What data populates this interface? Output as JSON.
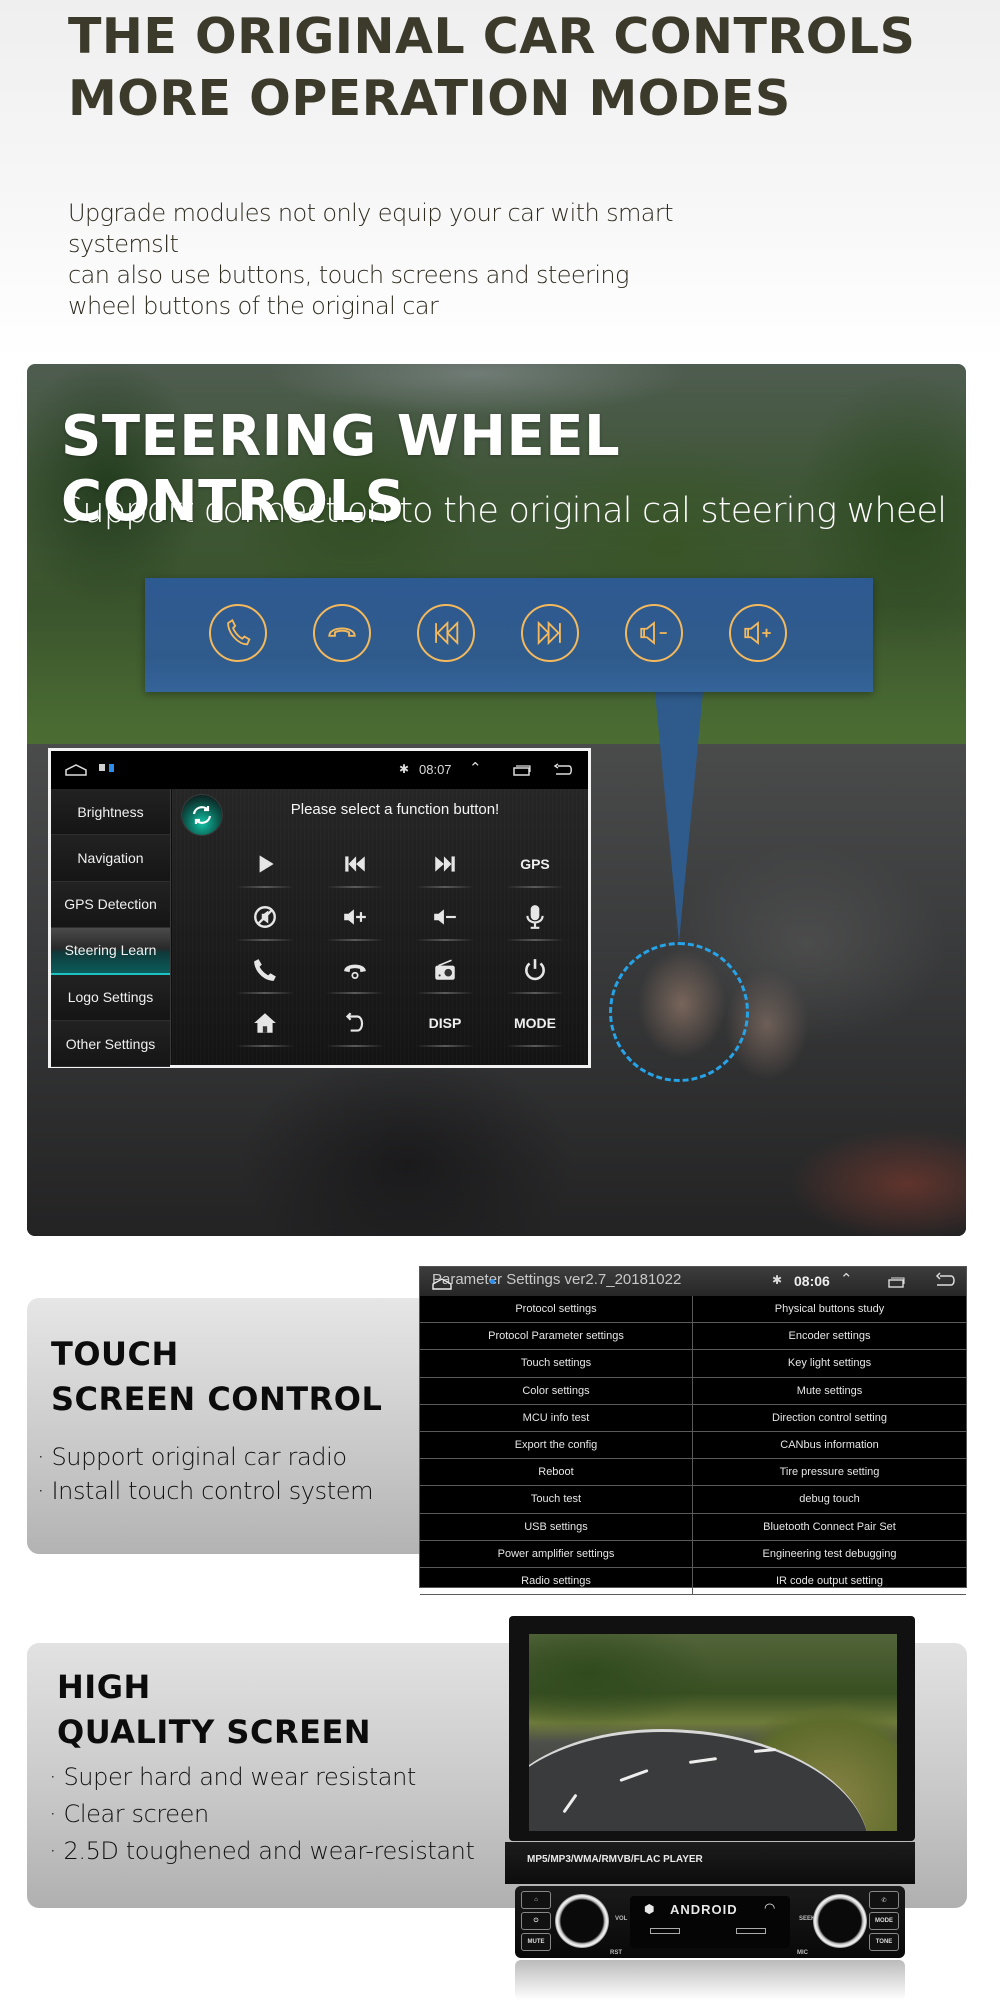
{
  "hero": {
    "title_line1": "THE ORIGINAL CAR CONTROLS",
    "title_line2": "MORE OPERATION MODES",
    "desc_line1": "Upgrade modules not only equip your car with smart systemsIt",
    "desc_line2": "can also use buttons, touch screens and steering",
    "desc_line3": "wheel buttons of the original car"
  },
  "steering": {
    "title": "STEERING WHEEL CONTROLS",
    "subtitle": "Support connection to the original cal steering wheel",
    "keys": [
      {
        "icon": "phone-answer-icon"
      },
      {
        "icon": "phone-hangup-icon"
      },
      {
        "icon": "previous-track-icon"
      },
      {
        "icon": "next-track-icon"
      },
      {
        "icon": "volume-down-icon"
      },
      {
        "icon": "volume-up-icon"
      }
    ],
    "accent_color": "#2f5b8c",
    "key_color": "#f4b95c",
    "highlight_color": "#27a3e8"
  },
  "unit": {
    "status": {
      "time": "08:07"
    },
    "sidebar": [
      {
        "label": "Brightness",
        "active": false
      },
      {
        "label": "Navigation",
        "active": false
      },
      {
        "label": "GPS Detection",
        "active": false
      },
      {
        "label": "Steering Learn",
        "active": true
      },
      {
        "label": "Logo Settings",
        "active": false
      },
      {
        "label": "Other Settings",
        "active": false
      }
    ],
    "prompt": "Please select a function button!",
    "functions": [
      {
        "icon": "play-icon",
        "label": ""
      },
      {
        "icon": "previous-track-icon",
        "label": ""
      },
      {
        "icon": "next-track-icon",
        "label": ""
      },
      {
        "icon": "",
        "label": "GPS"
      },
      {
        "icon": "mute-icon",
        "label": ""
      },
      {
        "icon": "volume-up-icon",
        "label": ""
      },
      {
        "icon": "volume-down-icon",
        "label": ""
      },
      {
        "icon": "microphone-icon",
        "label": ""
      },
      {
        "icon": "phone-answer-icon",
        "label": ""
      },
      {
        "icon": "phone-hangup-icon",
        "label": ""
      },
      {
        "icon": "radio-icon",
        "label": ""
      },
      {
        "icon": "power-icon",
        "label": ""
      },
      {
        "icon": "home-icon",
        "label": ""
      },
      {
        "icon": "back-icon",
        "label": ""
      },
      {
        "icon": "",
        "label": "DISP"
      },
      {
        "icon": "",
        "label": "MODE"
      }
    ]
  },
  "touch": {
    "title_line1": "TOUCH",
    "title_line2": "SCREEN CONTROL",
    "bullets": [
      "Support original car radio",
      "Install touch control system"
    ]
  },
  "param": {
    "title": "Parameter Settings ver2.7_20181022",
    "time": "08:06",
    "rows": [
      [
        "Protocol settings",
        "Physical buttons study"
      ],
      [
        "Protocol Parameter settings",
        "Encoder settings"
      ],
      [
        "Touch settings",
        "Key light settings"
      ],
      [
        "Color settings",
        "Mute settings"
      ],
      [
        "MCU info test",
        "Direction control setting"
      ],
      [
        "Export the config",
        "CANbus information"
      ],
      [
        "Reboot",
        "Tire pressure setting"
      ],
      [
        "Touch test",
        "debug touch"
      ],
      [
        "USB settings",
        "Bluetooth Connect Pair Set"
      ],
      [
        "Power amplifier settings",
        "Engineering test debugging"
      ],
      [
        "Radio settings",
        "IR code output setting"
      ]
    ]
  },
  "quality": {
    "title_line1": "HIGH",
    "title_line2": "QUALITY SCREEN",
    "bullets": [
      "Super hard and wear resistant",
      "Clear screen",
      "2.5D toughened and wear-resistant"
    ]
  },
  "stereo": {
    "label": "MP5/MP3/WMA/RMVB/FLAC  PLAYER",
    "brand": "ANDROID",
    "buttons_left": [
      "MUTE"
    ],
    "buttons_right": [
      "MODE",
      "TONE"
    ],
    "small_labels": {
      "vol": "VOL",
      "seek": "SEEK",
      "rst": "RST",
      "mic": "MIC"
    }
  }
}
